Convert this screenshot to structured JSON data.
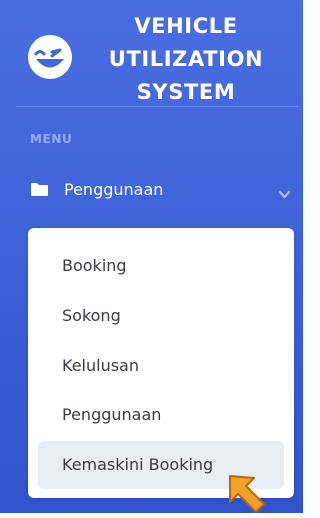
{
  "brand": {
    "title_lines": [
      "VEHICLE",
      "UTILIZATION",
      "SYSTEM"
    ],
    "icon": "laughing-wink-face-icon"
  },
  "sidebar": {
    "heading": "MENU",
    "nav": {
      "icon": "folder-icon",
      "label": "Penggunaan",
      "expanded": true,
      "toggle_icon": "chevron-down-icon"
    },
    "submenu": [
      {
        "label": "Booking"
      },
      {
        "label": "Sokong"
      },
      {
        "label": "Kelulusan"
      },
      {
        "label": "Penggunaan"
      },
      {
        "label": "Kemaskini Booking",
        "active": true
      }
    ]
  },
  "pointer": {
    "icon": "orange-arrow-pointer-icon"
  },
  "colors": {
    "sidebar_top": "#4a6ee0",
    "sidebar_bottom": "#2f54cc",
    "submenu_bg": "#ffffff",
    "active_item_bg": "#eaecf4",
    "text_dark": "#3a3b45",
    "pointer_fill": "#f0a12a",
    "pointer_stroke": "#b06a10"
  }
}
